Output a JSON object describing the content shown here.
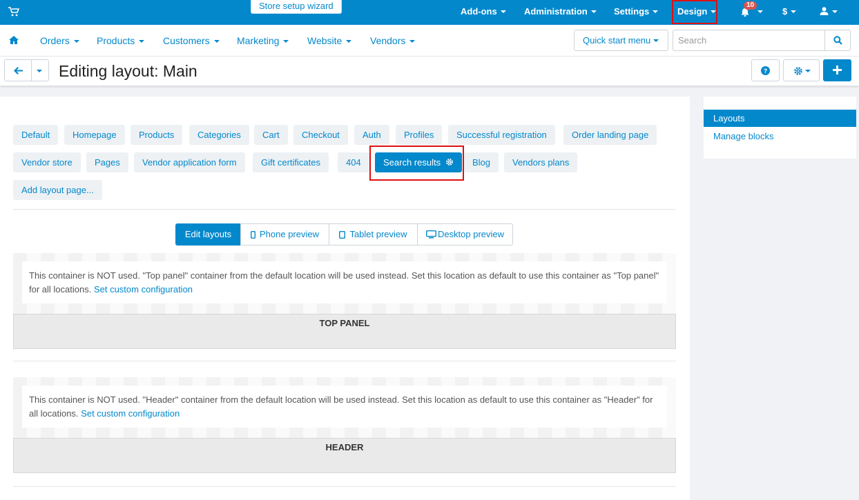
{
  "topbar": {
    "wizard": "Store setup wizard",
    "addons": "Add-ons",
    "administration": "Administration",
    "settings": "Settings",
    "design": "Design",
    "notifications_count": "10",
    "currency": "$"
  },
  "nav": {
    "orders": "Orders",
    "products": "Products",
    "customers": "Customers",
    "marketing": "Marketing",
    "website": "Website",
    "vendors": "Vendors",
    "quick_start": "Quick start menu",
    "search_placeholder": "Search"
  },
  "page": {
    "title": "Editing layout: Main"
  },
  "layout_pages": {
    "default": "Default",
    "homepage": "Homepage",
    "products": "Products",
    "categories": "Categories",
    "cart": "Cart",
    "checkout": "Checkout",
    "auth": "Auth",
    "profiles": "Profiles",
    "successful_registration": "Successful registration",
    "order_landing_page": "Order landing page",
    "vendor_store": "Vendor store",
    "pages": "Pages",
    "vendor_application_form": "Vendor application form",
    "gift_certificates": "Gift certificates",
    "p404": "404",
    "search_results": "Search results",
    "blog": "Blog",
    "vendors_plans": "Vendors plans",
    "add_layout_page": "Add layout page..."
  },
  "modes": {
    "edit": "Edit layouts",
    "phone": "Phone preview",
    "tablet": "Tablet preview",
    "desktop": "Desktop preview"
  },
  "containers": {
    "top_panel": {
      "notice": "This container is NOT used. \"Top panel\" container from the default location will be used instead. Set this location as default to use this container as \"Top panel\" for all locations.",
      "link": "Set custom configuration",
      "label": "TOP PANEL"
    },
    "header": {
      "notice": "This container is NOT used. \"Header\" container from the default location will be used instead. Set this location as default to use this container as \"Header\" for all locations.",
      "link": "Set custom configuration",
      "label": "HEADER"
    }
  },
  "sidebar": {
    "layouts": "Layouts",
    "manage_blocks": "Manage blocks"
  },
  "colors": {
    "accent": "#0388cc",
    "highlight": "#e01010",
    "badge": "#d9534f"
  }
}
